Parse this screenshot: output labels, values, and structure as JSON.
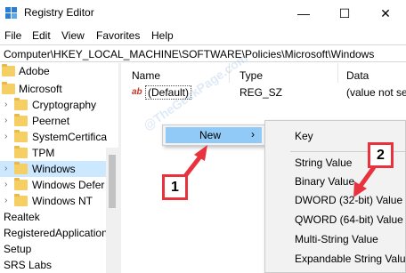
{
  "window": {
    "title": "Registry Editor",
    "controls": {
      "minimize": "—",
      "maximize": "☐",
      "close": "✕"
    }
  },
  "menu": [
    "File",
    "Edit",
    "View",
    "Favorites",
    "Help"
  ],
  "address": "Computer\\HKEY_LOCAL_MACHINE\\SOFTWARE\\Policies\\Microsoft\\Windows",
  "tree": [
    {
      "label": "Adobe",
      "expandable": false
    },
    {
      "label": "Microsoft",
      "expandable": false
    },
    {
      "label": "Cryptography",
      "expandable": true
    },
    {
      "label": "Peernet",
      "expandable": true
    },
    {
      "label": "SystemCertifica",
      "expandable": true
    },
    {
      "label": "TPM",
      "expandable": false
    },
    {
      "label": "Windows",
      "expandable": true,
      "selected": true
    },
    {
      "label": "Windows Defer",
      "expandable": true
    },
    {
      "label": "Windows NT",
      "expandable": true
    },
    {
      "label": "Realtek",
      "expandable": false
    },
    {
      "label": "RegisteredApplication",
      "expandable": false
    },
    {
      "label": "Setup",
      "expandable": false
    },
    {
      "label": "SRS Labs",
      "expandable": false
    }
  ],
  "list": {
    "columns": [
      "Name",
      "Type",
      "Data"
    ],
    "rows": [
      {
        "name": "(Default)",
        "type": "REG_SZ",
        "data": "(value not se"
      }
    ]
  },
  "context_menu": {
    "new_label": "New",
    "new_arrow": "›"
  },
  "submenu": {
    "items": [
      "Key",
      "String Value",
      "Binary Value",
      "DWORD (32-bit) Value",
      "QWORD (64-bit) Value",
      "Multi-String Value",
      "Expandable String Value"
    ]
  },
  "annotations": {
    "step1": "1",
    "step2": "2"
  },
  "watermark": "@TheGeekPage.com",
  "colors": {
    "highlight": "#91c9f7",
    "selected_tree": "#cce8ff",
    "arrow": "#e8323d",
    "folder": "#f5cf63"
  }
}
